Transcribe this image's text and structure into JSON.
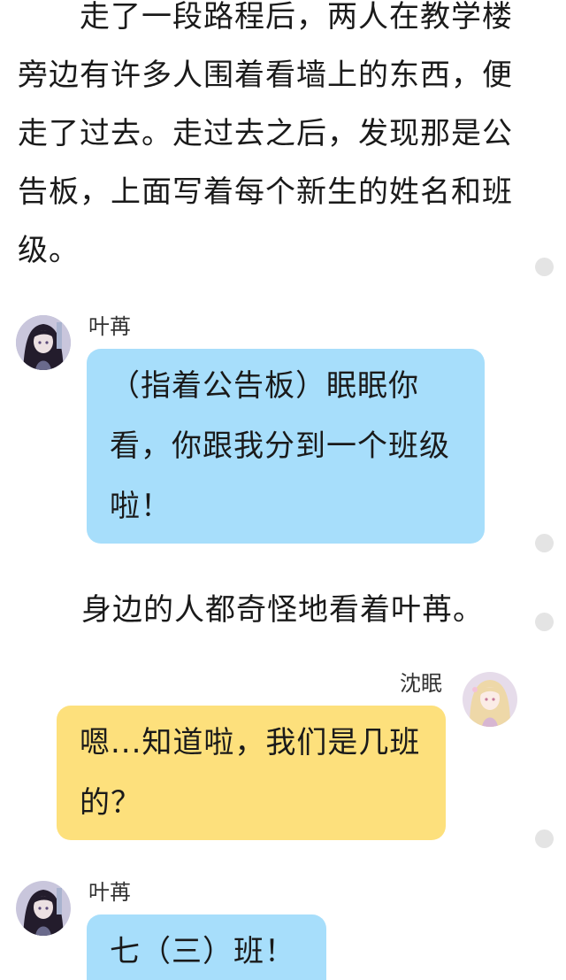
{
  "narration": {
    "top": "走了一段路程后，两人在教学楼旁边有许多人围着看墙上的东西，便走了过去。走过去之后，发现那是公告板，上面写着每个新生的姓名和班级。",
    "middle": "身边的人都奇怪地看着叶苒。"
  },
  "messages": [
    {
      "speaker": "叶苒",
      "text": "（指着公告板）眠眠你看，你跟我分到一个班级啦！"
    },
    {
      "speaker": "沈眠",
      "text": "嗯...知道啦，我们是几班的？"
    },
    {
      "speaker": "叶苒",
      "text": "七（三）班！"
    }
  ],
  "colors": {
    "left_bubble": "#a7defb",
    "right_bubble": "#fde07c",
    "side_dot": "#e4e4e4"
  },
  "icons": {
    "avatar_left": "dark-haired-girl-avatar",
    "avatar_right": "blonde-girl-avatar",
    "side_dot": "comment-dot-icon"
  }
}
